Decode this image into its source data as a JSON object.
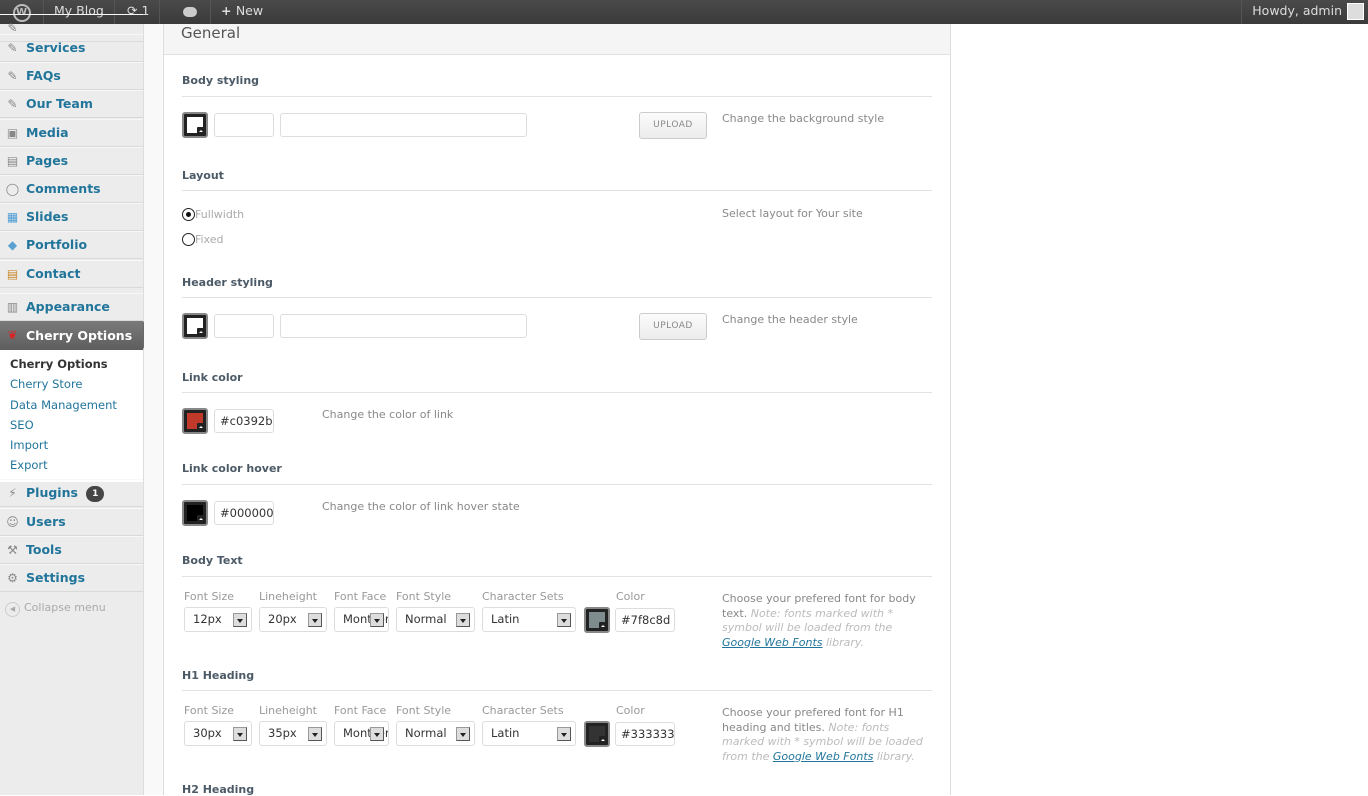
{
  "adminbar": {
    "site": "My Blog",
    "updates": "1",
    "new": "New",
    "howdy": "Howdy, admin"
  },
  "sidebar": {
    "items": [
      {
        "label": "Services",
        "icon": "pin-icon"
      },
      {
        "label": "FAQs",
        "icon": "pin-icon"
      },
      {
        "label": "Our Team",
        "icon": "pin-icon"
      },
      {
        "label": "Media",
        "icon": "media-icon"
      },
      {
        "label": "Pages",
        "icon": "pages-icon"
      },
      {
        "label": "Comments",
        "icon": "comments-icon"
      },
      {
        "label": "Slides",
        "icon": "slides-icon"
      },
      {
        "label": "Portfolio",
        "icon": "portfolio-icon"
      },
      {
        "label": "Contact",
        "icon": "contact-icon"
      },
      {
        "label": "Appearance",
        "icon": "appearance-icon"
      },
      {
        "label": "Cherry Options",
        "icon": "cherry-icon"
      },
      {
        "label": "Plugins",
        "icon": "plugins-icon",
        "badge": "1"
      },
      {
        "label": "Users",
        "icon": "users-icon"
      },
      {
        "label": "Tools",
        "icon": "tools-icon"
      },
      {
        "label": "Settings",
        "icon": "settings-icon"
      }
    ],
    "submenu": [
      "Cherry Options",
      "Cherry Store",
      "Data Management",
      "SEO",
      "Import",
      "Export"
    ],
    "collapse": "Collapse menu"
  },
  "panel": {
    "title": "General",
    "body_styling": {
      "label": "Body styling",
      "upload": "UPLOAD",
      "desc": "Change the background style",
      "color_value": "",
      "image_value": ""
    },
    "layout": {
      "label": "Layout",
      "options": [
        "Fullwidth",
        "Fixed"
      ],
      "selected": "Fullwidth",
      "desc": "Select layout for Your site"
    },
    "header_styling": {
      "label": "Header styling",
      "upload": "UPLOAD",
      "desc": "Change the header style"
    },
    "link_color": {
      "label": "Link color",
      "value": "#c0392b",
      "desc": "Change the color of link"
    },
    "link_hover": {
      "label": "Link color hover",
      "value": "#000000",
      "desc": "Change the color of link hover state"
    },
    "field_labels": {
      "size": "Font Size",
      "lineheight": "Lineheight",
      "face": "Font Face",
      "style": "Font Style",
      "charset": "Character Sets",
      "color": "Color"
    },
    "body_text": {
      "label": "Body Text",
      "size": "12px",
      "lineheight": "20px",
      "face": "Montserrat",
      "style": "Normal",
      "charset": "Latin",
      "color": "#7f8c8d",
      "desc": "Choose your prefered font for body text.",
      "note": "Note: fonts marked with * symbol will be loaded from the",
      "link": "Google Web Fonts",
      "tail": "library."
    },
    "h1": {
      "label": "H1 Heading",
      "size": "30px",
      "lineheight": "35px",
      "face": "Montserrat",
      "style": "Normal",
      "charset": "Latin",
      "color": "#333333",
      "desc": "Choose your prefered font for H1 heading and titles.",
      "note": "Note: fonts marked with * symbol will be loaded from the",
      "link": "Google Web Fonts",
      "tail": "library."
    },
    "h2": {
      "label": "H2 Heading"
    }
  }
}
